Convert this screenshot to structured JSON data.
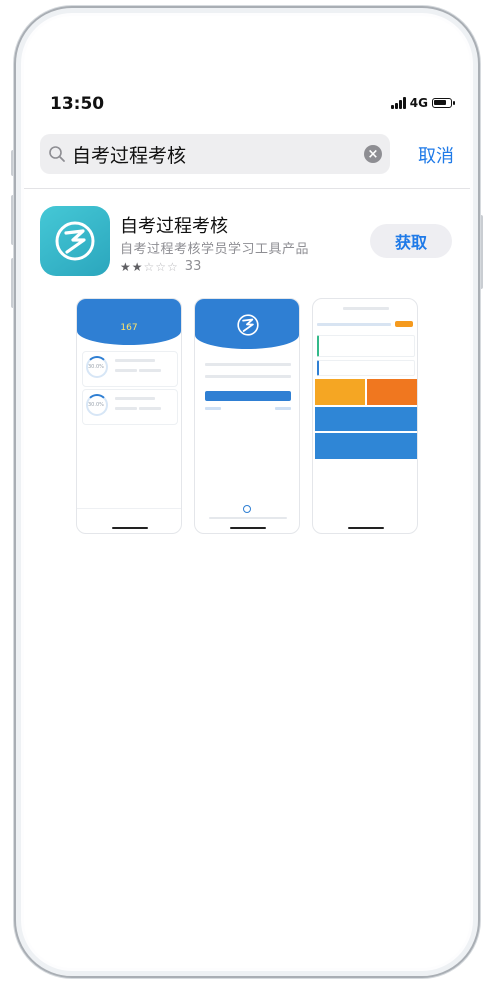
{
  "status": {
    "time": "13:50",
    "network": "4G"
  },
  "search": {
    "query": "自考过程考核",
    "cancel_label": "取消"
  },
  "app": {
    "name": "自考过程考核",
    "subtitle": "自考过程考核学员学习工具产品",
    "rating": 2,
    "rating_count": "33",
    "get_label": "获取"
  },
  "screenshots": {
    "s1": {
      "count": "167",
      "pct_a": "30.0%",
      "pct_b": "30.0%"
    },
    "s3": {}
  },
  "colors": {
    "accent": "#1f7ae8",
    "app_icon": "#36b7cb",
    "screenshot_blue": "#2f7fd3",
    "orange": "#f59a1e"
  }
}
